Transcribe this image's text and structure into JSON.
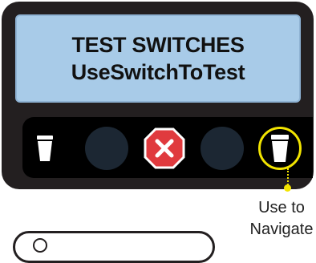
{
  "display": {
    "line1": "TEST SWITCHES",
    "line2": "UseSwitchToTest"
  },
  "buttons": [
    {
      "name": "cup-indicator",
      "icon": "cup-icon"
    },
    {
      "name": "blank-button-left",
      "icon": ""
    },
    {
      "name": "stop-button",
      "icon": "stop-x-icon"
    },
    {
      "name": "blank-button-right",
      "icon": ""
    },
    {
      "name": "cup-button-navigate",
      "icon": "cup-icon"
    }
  ],
  "callout": {
    "line1": "Use to",
    "line2": "Navigate"
  },
  "colors": {
    "body": "#231f20",
    "lcd": "#a8cbe8",
    "button": "#1c2733",
    "stop": "#e03a3e",
    "highlight": "#f2e400"
  }
}
